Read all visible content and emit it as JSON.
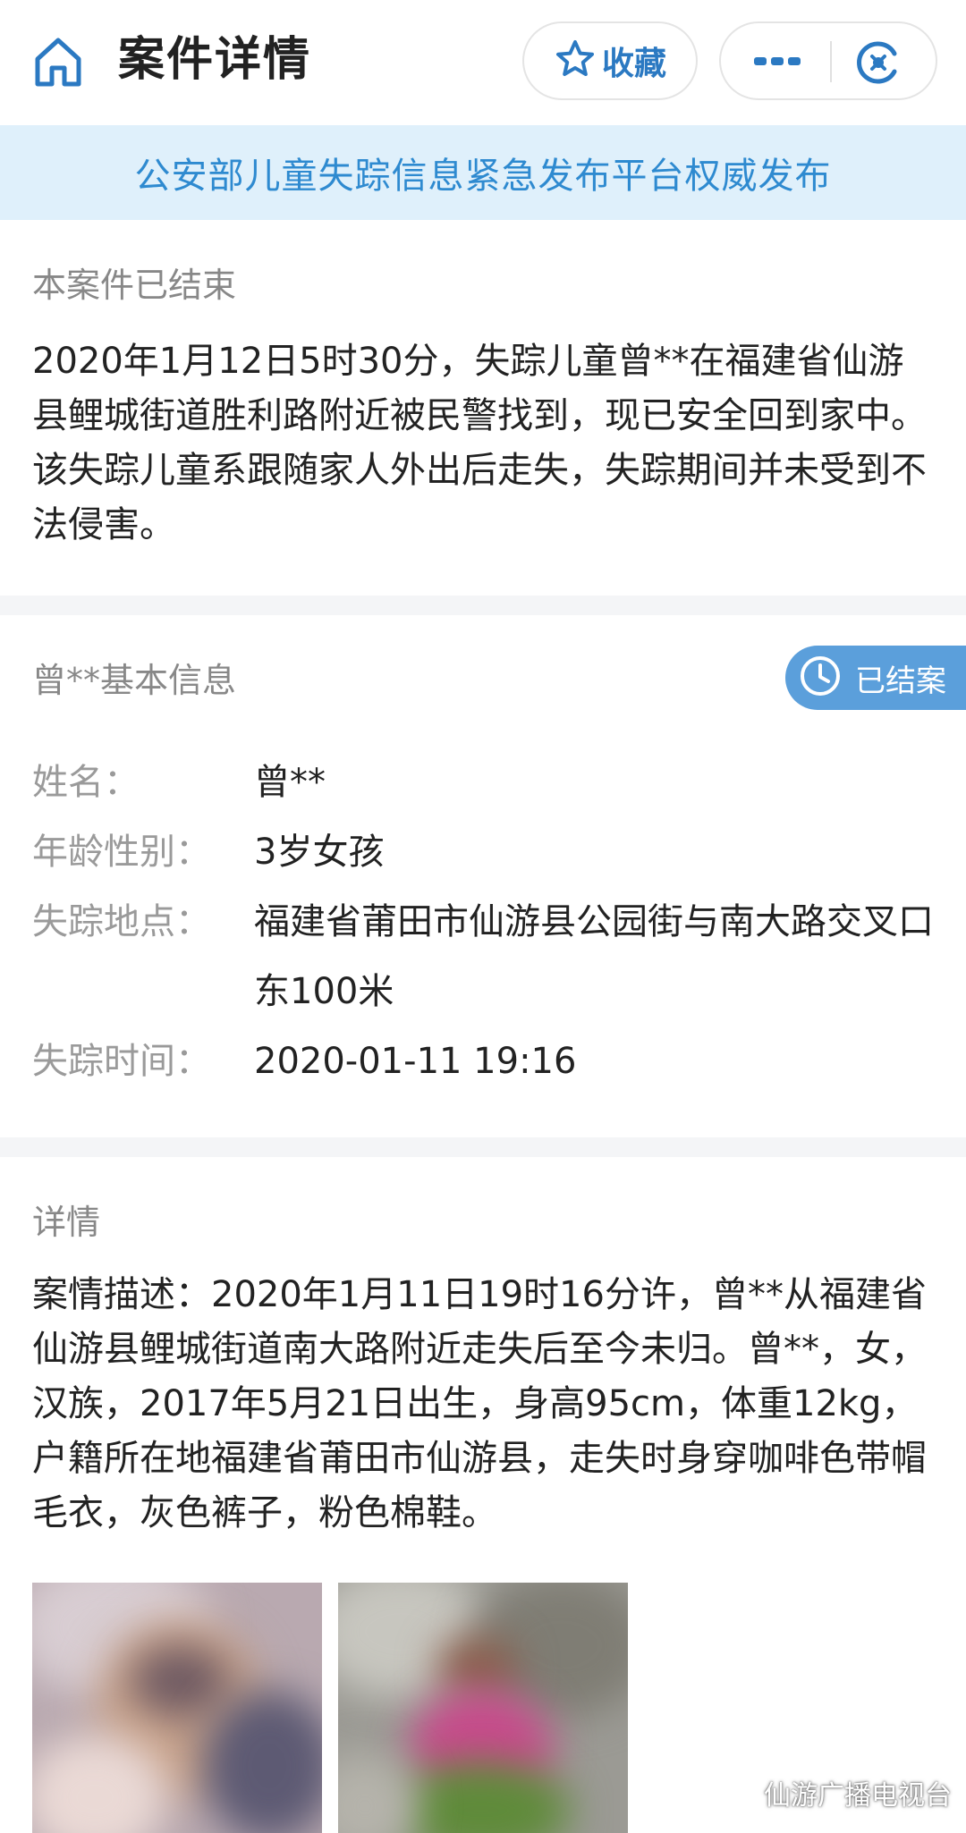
{
  "header": {
    "title": "案件详情",
    "favorite_label": "收藏"
  },
  "banner": {
    "text": "公安部儿童失踪信息紧急发布平台权威发布"
  },
  "closed_notice": {
    "title": "本案件已结束",
    "text": "2020年1月12日5时30分，失踪儿童曾**在福建省仙游县鲤城街道胜利路附近被民警找到，现已安全回到家中。该失踪儿童系跟随家人外出后走失，失踪期间并未受到不法侵害。"
  },
  "basic_info": {
    "title": "曾**基本信息",
    "status_badge": "已结案",
    "rows": [
      {
        "label": "姓名：",
        "value": "曾**"
      },
      {
        "label": "年龄性别：",
        "value": "3岁女孩"
      },
      {
        "label": "失踪地点：",
        "value": "福建省莆田市仙游县公园街与南大路交叉口东100米"
      },
      {
        "label": "失踪时间：",
        "value": "2020-01-11 19:16"
      }
    ]
  },
  "details": {
    "title": "详情",
    "text": "案情描述：2020年1月11日19时16分许，曾**从福建省仙游县鲤城街道南大路附近走失后至今未归。曾**，女，汉族，2017年5月21日出生，身高95cm，体重12kg，户籍所在地福建省莆田市仙游县，走失时身穿咖啡色带帽毛衣，灰色裤子，粉色棉鞋。"
  },
  "watermark": {
    "text": "仙游广播电视台"
  },
  "colors": {
    "accent": "#2b79c2",
    "banner_bg": "#dff0fb",
    "banner_text": "#2e8ad0",
    "status_badge": "#5b9fdb",
    "section_gap": "#f4f5f7"
  }
}
